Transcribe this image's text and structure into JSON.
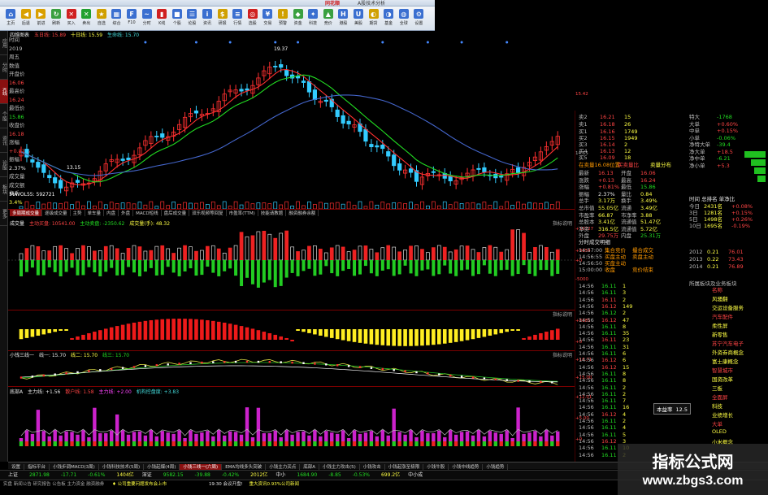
{
  "window": {
    "title": "同花顺",
    "subtitle": "A股技术分析"
  },
  "toolbar": [
    {
      "label": "主页",
      "color": "#3a6fd0",
      "icon": "home-icon",
      "glyph": "⌂"
    },
    {
      "label": "后退",
      "color": "#d9a000",
      "icon": "back-icon",
      "glyph": "◀"
    },
    {
      "label": "前进",
      "color": "#d9a000",
      "icon": "forward-icon",
      "glyph": "▶"
    },
    {
      "label": "刷新",
      "color": "#3aa040",
      "icon": "refresh-icon",
      "glyph": "↻"
    },
    {
      "label": "买入",
      "color": "#d02020",
      "icon": "buy-icon",
      "glyph": "✕"
    },
    {
      "label": "卖出",
      "color": "#20a030",
      "icon": "sell-icon",
      "glyph": "✕"
    },
    {
      "label": "自选",
      "color": "#d0a000",
      "icon": "star-icon",
      "glyph": "★"
    },
    {
      "label": "综合",
      "color": "#3a6fd0",
      "icon": "grid-icon",
      "glyph": "▦"
    },
    {
      "label": "F10",
      "color": "#3a6fd0",
      "icon": "f10-icon",
      "glyph": "F"
    },
    {
      "label": "分时",
      "color": "#3a6fd0",
      "icon": "timeshare-icon",
      "glyph": "~"
    },
    {
      "label": "K线",
      "color": "#d02020",
      "icon": "kline-icon",
      "glyph": "▮"
    },
    {
      "label": "个股",
      "color": "#3a6fd0",
      "icon": "stock-icon",
      "glyph": "■"
    },
    {
      "label": "论股",
      "color": "#3a6fd0",
      "icon": "chat-icon",
      "glyph": "☰"
    },
    {
      "label": "资讯",
      "color": "#3a6fd0",
      "icon": "news-icon",
      "glyph": "i"
    },
    {
      "label": "研报",
      "color": "#d0a000",
      "icon": "report-icon",
      "glyph": "$"
    },
    {
      "label": "行情",
      "color": "#3a6fd0",
      "icon": "quote-icon",
      "glyph": "≡"
    },
    {
      "label": "选股",
      "color": "#d02020",
      "icon": "screener-icon",
      "glyph": "◎"
    },
    {
      "label": "交易",
      "color": "#3a6fd0",
      "icon": "trade-icon",
      "glyph": "¥"
    },
    {
      "label": "预警",
      "color": "#d0a000",
      "icon": "alert-icon",
      "glyph": "!"
    },
    {
      "label": "资金",
      "color": "#3aa040",
      "icon": "money-icon",
      "glyph": "◆"
    },
    {
      "label": "科技",
      "color": "#3a6fd0",
      "icon": "tech-icon",
      "glyph": "✦"
    },
    {
      "label": "竞价",
      "color": "#3aa040",
      "icon": "auction-icon",
      "glyph": "▲"
    },
    {
      "label": "港股",
      "color": "#3a6fd0",
      "icon": "hk-icon",
      "glyph": "H"
    },
    {
      "label": "美股",
      "color": "#3a6fd0",
      "icon": "us-icon",
      "glyph": "U"
    },
    {
      "label": "期货",
      "color": "#d0a000",
      "icon": "futures-icon",
      "glyph": "◐"
    },
    {
      "label": "基金",
      "color": "#3a6fd0",
      "icon": "fund-icon",
      "glyph": "◑"
    },
    {
      "label": "全球",
      "color": "#3a6fd0",
      "icon": "globe-icon",
      "glyph": "◍"
    },
    {
      "label": "设置",
      "color": "#3a6fd0",
      "icon": "settings-icon",
      "glyph": "⚙"
    }
  ],
  "leftnav": [
    "应用",
    "分时",
    "K线",
    "个股",
    "资讯",
    "论股",
    "板块",
    "更多"
  ],
  "info": [
    {
      "l": "时间",
      "v": "",
      "c": "w"
    },
    {
      "l": "2019",
      "v": "",
      "c": "w"
    },
    {
      "l": "周五",
      "v": "",
      "c": "w"
    },
    {
      "l": "数值",
      "v": "",
      "c": "w"
    },
    {
      "l": "开盘价",
      "v": "16.06",
      "c": "r"
    },
    {
      "l": "最高价",
      "v": "16.24",
      "c": "r"
    },
    {
      "l": "最低价",
      "v": "15.86",
      "c": "g"
    },
    {
      "l": "收盘价",
      "v": "16.18",
      "c": "r"
    },
    {
      "l": "涨幅",
      "v": "+0.81%",
      "c": "r"
    },
    {
      "l": "振幅",
      "v": "2.37%",
      "c": "w"
    },
    {
      "l": "成交量",
      "v": "",
      "c": "y"
    },
    {
      "l": "成交额",
      "v": "",
      "c": "y"
    },
    {
      "l": "换手",
      "v": "3.4%",
      "c": "y"
    }
  ],
  "main_header": {
    "name": "四维图表",
    "ma1": "五日线: 15.89",
    "ma2": "十日线: 15.59",
    "ma3": "生命线: 15.70"
  },
  "price_axis": [
    "19.37",
    "15.42",
    "14.55",
    "13.15"
  ],
  "annot_high": "19.37",
  "annot_low": "13.15",
  "volume_header": "MAVOL55: 592721",
  "indicator_tabs": [
    "多周期成交量",
    "逐级成交量",
    "主势",
    "单车量",
    "内盘",
    "外盘",
    "MACD短线",
    "盘后成交量",
    "双乐视频等回复",
    "市盈率(TTM)",
    "技能请教题",
    "融资融券余额"
  ],
  "panel1": {
    "title": "成交量",
    "label1": "主动买盘: 10541.00",
    "label2": "主动卖盘: -2350.62",
    "label3": "成交量(手): 48.32",
    "btn": "指标说明",
    "axis": [
      "+10727",
      "+9154",
      "+0",
      "-5000"
    ]
  },
  "panel2": {
    "btn": "指标说明",
    "axis": [
      "+8181",
      "+0"
    ]
  },
  "panel3": {
    "title": "小钱三线一",
    "v1": "线一: 15.70",
    "v2": "线二: 15.70",
    "v3": "线三: 15.70",
    "btn": "指标说明",
    "axis": [
      "+16.71",
      "+15.00"
    ]
  },
  "panel4": {
    "title": "底部A",
    "v1": "主力线: +1.56",
    "v2": "散户线: 1.58",
    "v3": "主力线: +2.00",
    "v4": "机构控盘度: +3.83",
    "btn": "指标说明",
    "axis": [
      "+12.01",
      "+5.00",
      "+0"
    ]
  },
  "bottom_tabs": [
    "设置",
    "指标平台",
    "小钱步调MACD(3周)",
    "小钱科技技术(5周)",
    "小钱起爆(4周)",
    "小钱三线一(六周)",
    "EMA均线多头突破",
    "小钱主力买点",
    "底部A",
    "小钱主力攻击(5)",
    "小钱攻击",
    "小钱起涨至极限",
    "小钱牛股",
    "小钱中线趋势",
    "小钱趋势"
  ],
  "bottom_tab_selected": 5,
  "index_bar": [
    {
      "t": "上证",
      "c": "w"
    },
    {
      "t": "2871.98",
      "c": "g"
    },
    {
      "t": "-17.71",
      "c": "g"
    },
    {
      "t": "-0.61%",
      "c": "g"
    },
    {
      "t": "1404亿",
      "c": "y"
    },
    {
      "t": "深证",
      "c": "w"
    },
    {
      "t": "9582.15",
      "c": "g"
    },
    {
      "t": "-39.88",
      "c": "g"
    },
    {
      "t": "-0.42%",
      "c": "g"
    },
    {
      "t": "2012亿",
      "c": "y"
    },
    {
      "t": "中小",
      "c": "w"
    },
    {
      "t": "1684.90",
      "c": "g"
    },
    {
      "t": "-8.85",
      "c": "g"
    },
    {
      "t": "-0.53%",
      "c": "g"
    },
    {
      "t": "699.2亿",
      "c": "y"
    },
    {
      "t": "中小成",
      "c": "w"
    }
  ],
  "news": {
    "left": "实盘 新闻公告 研究报告 公告板 主力资金 融资融券",
    "ticker": "♦ 公司重要问题发布会上市",
    "mid": "19:30 会议开盘!",
    "right": "重大资讯0.93%公司新闻"
  },
  "quote": {
    "asks": [
      {
        "n": "卖2",
        "p": "16.21",
        "v": "15"
      },
      {
        "n": "卖1",
        "p": "16.18",
        "v": "26"
      }
    ],
    "bids": [
      {
        "n": "买1",
        "p": "16.16",
        "v": "1749"
      },
      {
        "n": "买2",
        "p": "16.15",
        "v": "1949"
      },
      {
        "n": "买3",
        "p": "16.14",
        "v": "2"
      },
      {
        "n": "买4",
        "p": "16.13",
        "v": "12"
      },
      {
        "n": "买5",
        "p": "16.09",
        "v": "18"
      }
    ],
    "banner": "在卖量16.08位置",
    "banner2": "买卖量比",
    "banner3": "卖量分布",
    "stats": [
      {
        "l": "最新",
        "v": "16.13",
        "c": "r",
        "l2": "开盘",
        "v2": "16.06",
        "c2": "r"
      },
      {
        "l": "涨跌",
        "v": "+0.13",
        "c": "r",
        "l2": "最高",
        "v2": "16.24",
        "c2": "r"
      },
      {
        "l": "涨幅",
        "v": "+0.81%",
        "c": "r",
        "l2": "最低",
        "v2": "15.86",
        "c2": "g"
      },
      {
        "l": "振幅",
        "v": "2.37%",
        "c": "w",
        "l2": "量比",
        "v2": "0.84",
        "c2": "y"
      },
      {
        "l": "总手",
        "v": "3.17万",
        "c": "y",
        "l2": "换手",
        "v2": "3.49%",
        "c2": "y"
      },
      {
        "l": "总市值",
        "v": "55.05亿",
        "c": "y",
        "l2": "流通",
        "v2": "3.49亿",
        "c2": "y"
      },
      {
        "l": "市盈率",
        "v": "66.87",
        "c": "y",
        "l2": "市净率",
        "v2": "3.88",
        "c2": "y"
      },
      {
        "l": "总股本",
        "v": "3.41亿",
        "c": "y",
        "l2": "流通值",
        "v2": "51.47亿",
        "c2": "y"
      },
      {
        "l": "净资",
        "v": "316.5亿",
        "c": "y",
        "l2": "流通值",
        "v2": "5.72亿",
        "c2": "y"
      },
      {
        "l": "外盘",
        "v": "29.75万",
        "c": "r",
        "l2": "内盘",
        "v2": "25.31万",
        "c2": "g"
      }
    ],
    "flow": [
      {
        "l": "特大",
        "v": "-1768",
        "c": "g"
      },
      {
        "l": "大单",
        "v": "+0.60%",
        "c": "r"
      },
      {
        "l": "中单",
        "v": "+0.15%",
        "c": "r"
      },
      {
        "l": "小单",
        "v": "-0.06%",
        "c": "g"
      },
      {
        "l": "净特大单",
        "v": "-39.4",
        "c": "g"
      },
      {
        "l": "净大单",
        "v": "+18.5",
        "c": "r"
      },
      {
        "l": "净中单",
        "v": "-6.21",
        "c": "g"
      },
      {
        "l": "净小单",
        "v": "+5.3",
        "c": "r"
      }
    ],
    "flow_header": "时间 总排名 单净比",
    "flow_rows": [
      {
        "a": "今日",
        "b": "2431名",
        "c": "+0.08%"
      },
      {
        "a": "3日",
        "b": "1281名",
        "c": "+0.15%"
      },
      {
        "a": "5日",
        "b": "1498名",
        "c": "+0.26%"
      },
      {
        "a": "10日",
        "b": "1695名",
        "c": "-0.19%"
      }
    ],
    "ticks": [
      {
        "t": "14:56",
        "p": "16.11",
        "v": "1",
        "d": "g"
      },
      {
        "t": "14:56",
        "p": "16.11",
        "v": "3",
        "d": "g"
      },
      {
        "t": "14:56",
        "p": "16.11",
        "v": "2",
        "d": "r"
      },
      {
        "t": "14:56",
        "p": "16.12",
        "v": "149",
        "d": "r"
      },
      {
        "t": "14:56",
        "p": "16.12",
        "v": "2",
        "d": "g"
      },
      {
        "t": "14:56",
        "p": "16.12",
        "v": "47",
        "d": "r"
      },
      {
        "t": "14:56",
        "p": "16.11",
        "v": "8",
        "d": "g"
      },
      {
        "t": "14:56",
        "p": "16.11",
        "v": "35",
        "d": "g"
      },
      {
        "t": "14:56",
        "p": "16.11",
        "v": "23",
        "d": "r"
      },
      {
        "t": "14:56",
        "p": "16.11",
        "v": "31",
        "d": "g"
      },
      {
        "t": "14:56",
        "p": "16.11",
        "v": "6",
        "d": "g"
      },
      {
        "t": "14:56",
        "p": "16.12",
        "v": "6",
        "d": "r"
      },
      {
        "t": "14:56",
        "p": "16.12",
        "v": "15",
        "d": "r"
      },
      {
        "t": "14:56",
        "p": "16.11",
        "v": "8",
        "d": "g"
      },
      {
        "t": "14:56",
        "p": "16.11",
        "v": "8",
        "d": "g"
      },
      {
        "t": "14:56",
        "p": "16.11",
        "v": "2",
        "d": "g"
      },
      {
        "t": "14:56",
        "p": "16.11",
        "v": "2",
        "d": "g"
      },
      {
        "t": "14:56",
        "p": "16.11",
        "v": "7",
        "d": "g"
      },
      {
        "t": "14:56",
        "p": "16.11",
        "v": "16",
        "d": "g"
      },
      {
        "t": "14:56",
        "p": "16.12",
        "v": "4",
        "d": "r"
      },
      {
        "t": "14:56",
        "p": "16.11",
        "v": "2",
        "d": "g"
      },
      {
        "t": "14:56",
        "p": "16.11",
        "v": "4",
        "d": "g"
      },
      {
        "t": "14:56",
        "p": "16.11",
        "v": "5",
        "d": "g"
      },
      {
        "t": "14:56",
        "p": "16.12",
        "v": "3",
        "d": "r"
      },
      {
        "t": "14:56",
        "p": "16.11",
        "v": "10",
        "d": "g"
      },
      {
        "t": "14:56",
        "p": "16.11",
        "v": "2",
        "d": "g"
      }
    ],
    "sector_header": "所属板块及业务板块",
    "sectors": [
      "名称",
      "风骚翻",
      "交运设备服务",
      "汽车配件",
      "柔性屏",
      "新零售",
      "苏宁汽车电子",
      "外资券商概念",
      "富士康概念",
      "智慧城市",
      "国资改革",
      "三板",
      "全面屏",
      "科技",
      "业绩增长",
      "大单",
      "OLED",
      "小米概念"
    ],
    "popup": "本益率",
    "popup_val": "12.5",
    "news_rows": [
      {
        "a": "2012",
        "b": "0.21",
        "c": "76.01"
      },
      {
        "a": "2013",
        "b": "0.22",
        "c": "73.43"
      },
      {
        "a": "2014",
        "b": "0.21",
        "c": "76.89"
      }
    ],
    "hist_header": "分时成交明细",
    "hist_rows": [
      {
        "a": "14:57:00",
        "b": "集合竞价",
        "c": "撮合成交"
      },
      {
        "a": "14:56:55",
        "b": "买盘主动",
        "c": "卖盘主动"
      },
      {
        "a": "14:56:50",
        "b": "买盘主动",
        "c": ""
      },
      {
        "a": "15:00:00",
        "b": "收盘",
        "c": "竞价结束"
      }
    ]
  },
  "watermark": {
    "cn": "指标公式网",
    "url": "www.zbgs3.com"
  },
  "colors": {
    "up": "#ff3030",
    "down": "#20d020",
    "ma5": "#ffffff",
    "ma10": "#ffff00",
    "ma20": "#ff00ff",
    "ma60": "#00ff00",
    "life": "#4488ff"
  }
}
